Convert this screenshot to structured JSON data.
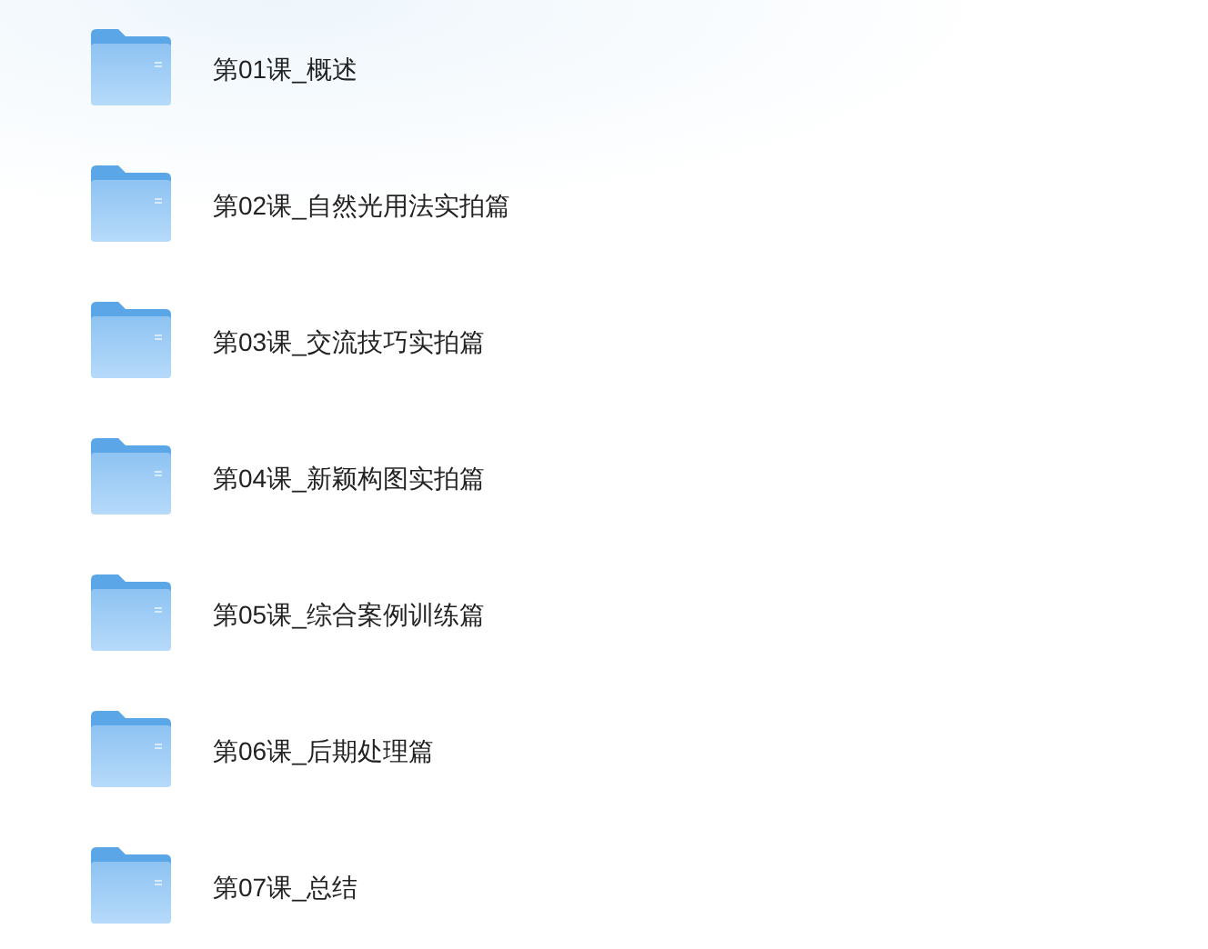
{
  "folders": [
    {
      "name": "第01课_概述"
    },
    {
      "name": "第02课_自然光用法实拍篇"
    },
    {
      "name": "第03课_交流技巧实拍篇"
    },
    {
      "name": "第04课_新颖构图实拍篇"
    },
    {
      "name": "第05课_综合案例训练篇"
    },
    {
      "name": "第06课_后期处理篇"
    },
    {
      "name": "第07课_总结"
    }
  ]
}
